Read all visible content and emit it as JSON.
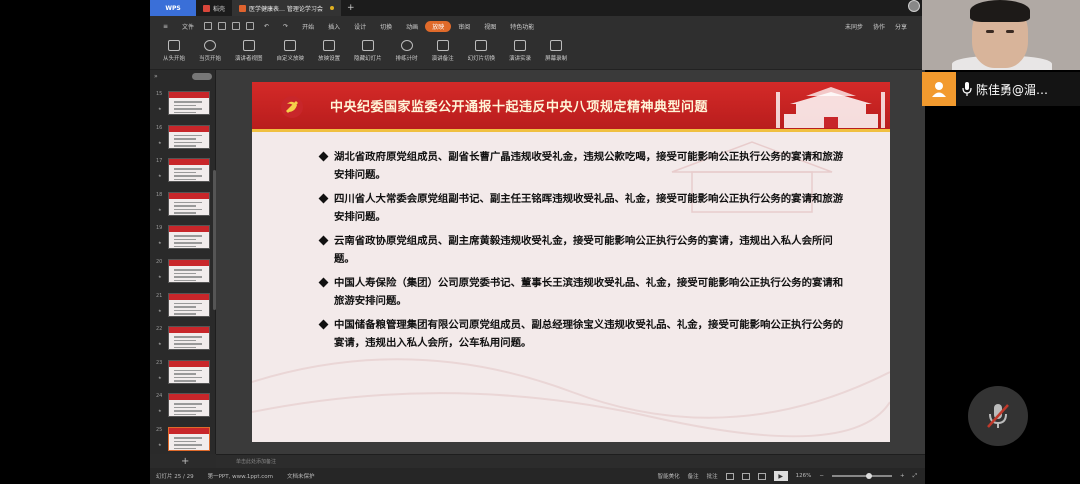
{
  "titlebar": {
    "app_tab": "WPS",
    "tabs": [
      {
        "label": "稻壳"
      },
      {
        "label": "医学健康表… 管理论学习会"
      }
    ]
  },
  "menubar": {
    "items": [
      "文件",
      "开始",
      "插入",
      "设计",
      "切换",
      "动画",
      "放映",
      "审阅",
      "视图",
      "特色功能"
    ],
    "selected": "放映",
    "right": [
      "未同步",
      "协作",
      "分享"
    ]
  },
  "ribbon": {
    "buttons": [
      "从头开始",
      "当页开始",
      "演讲者视图",
      "自定义放映",
      "放映设置",
      "隐藏幻灯片",
      "排练计时",
      "演讲备注",
      "幻灯片切换",
      "演讲实录",
      "屏幕录制"
    ]
  },
  "thumbnails": {
    "numbers": [
      "15",
      "16",
      "17",
      "18",
      "19",
      "20",
      "21",
      "22",
      "23",
      "24",
      "25"
    ],
    "selected": "25"
  },
  "slide": {
    "title": "中央纪委国家监委公开通报十起违反中央八项规定精神典型问题",
    "bullets": [
      "湖北省政府原党组成员、副省长曹广晶违规收受礼金，违规公款吃喝，接受可能影响公正执行公务的宴请和旅游安排问题。",
      "四川省人大常委会原党组副书记、副主任王铭晖违规收受礼品、礼金，接受可能影响公正执行公务的宴请和旅游安排问题。",
      "云南省政协原党组成员、副主席黄毅违规收受礼金，接受可能影响公正执行公务的宴请，违规出入私人会所问题。",
      "中国人寿保险（集团）公司原党委书记、董事长王滨违规收受礼品、礼金，接受可能影响公正执行公务的宴请和旅游安排问题。",
      "中国储备粮管理集团有限公司原党组成员、副总经理徐宝义违规收受礼品、礼金，接受可能影响公正执行公务的宴请，违规出入私人会所，公车私用问题。"
    ]
  },
  "notes": {
    "placeholder": "单击此处添加备注"
  },
  "statusbar": {
    "slide_count": "幻灯片 25 / 29",
    "theme": "第一PPT, www.1ppt.com",
    "doc_status": "文档未保护",
    "beautify": "智能美化",
    "notes_btn": "备注",
    "comments_btn": "批注",
    "zoom": "126%"
  },
  "video": {
    "participant_name": "陈佳勇@湄…"
  },
  "colors": {
    "header_red": "#c8262a",
    "accent_orange": "#e06a2a",
    "avatar_orange": "#f29a2e"
  }
}
